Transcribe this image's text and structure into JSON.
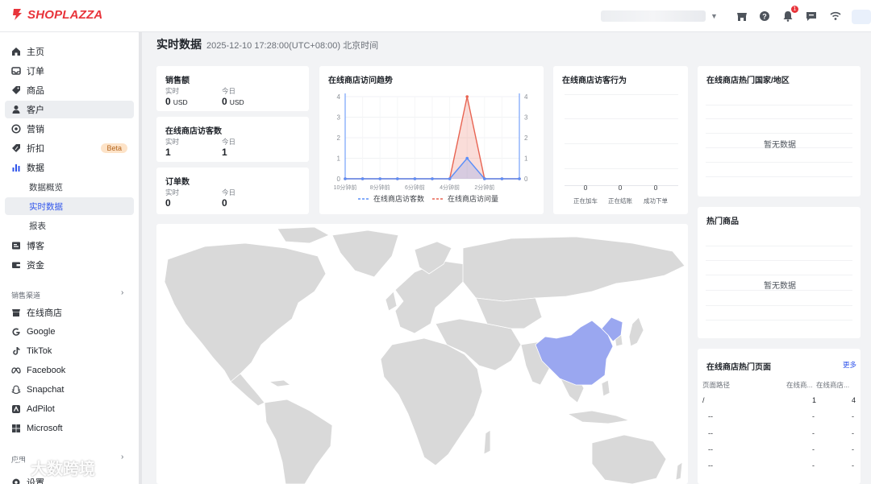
{
  "brand": {
    "name": "SHOPLAZZA",
    "accent": "#e8343b"
  },
  "topbar": {
    "icons": [
      "store-icon",
      "help-icon",
      "bell-icon",
      "message-icon",
      "wifi-icon"
    ],
    "notification_count": "1"
  },
  "sidebar": {
    "items": [
      {
        "label": "主页",
        "icon": "home-icon"
      },
      {
        "label": "订单",
        "icon": "inbox-icon"
      },
      {
        "label": "商品",
        "icon": "tag-icon"
      },
      {
        "label": "客户",
        "icon": "person-icon"
      },
      {
        "label": "营销",
        "icon": "target-icon"
      },
      {
        "label": "折扣",
        "icon": "discount-icon",
        "badge": "Beta"
      },
      {
        "label": "数据",
        "icon": "bar-chart-icon"
      },
      {
        "label": "数据概览"
      },
      {
        "label": "实时数据"
      },
      {
        "label": "报表"
      },
      {
        "label": "博客",
        "icon": "blog-icon"
      },
      {
        "label": "资金",
        "icon": "wallet-icon"
      }
    ],
    "channels_label": "销售渠道",
    "channels": [
      {
        "label": "在线商店",
        "icon": "store-icon"
      },
      {
        "label": "Google",
        "icon": "google-icon"
      },
      {
        "label": "TikTok",
        "icon": "tiktok-icon"
      },
      {
        "label": "Facebook",
        "icon": "meta-icon"
      },
      {
        "label": "Snapchat",
        "icon": "snapchat-icon"
      },
      {
        "label": "AdPilot",
        "icon": "adpilot-icon"
      },
      {
        "label": "Microsoft",
        "icon": "microsoft-icon"
      }
    ],
    "apps_label": "应用",
    "settings_label": "设置"
  },
  "header": {
    "title": "实时数据",
    "time": "2025-12-10 17:28:00(UTC+08:00) 北京时间"
  },
  "stats": [
    {
      "title": "销售额",
      "realtime_label": "实时",
      "today_label": "今日",
      "realtime": "0",
      "today": "0",
      "unit": "USD"
    },
    {
      "title": "在线商店访客数",
      "realtime_label": "实时",
      "today_label": "今日",
      "realtime": "1",
      "today": "1",
      "unit": ""
    },
    {
      "title": "订单数",
      "realtime_label": "实时",
      "today_label": "今日",
      "realtime": "0",
      "today": "0",
      "unit": ""
    }
  ],
  "trend": {
    "title": "在线商店访问趋势",
    "x_labels": [
      "10分钟前",
      "8分钟前",
      "6分钟前",
      "4分钟前",
      "2分钟前"
    ],
    "y_ticks": [
      "0",
      "1",
      "2",
      "3",
      "4"
    ],
    "legend": [
      "在线商店访客数",
      "在线商店访问量"
    ]
  },
  "chart_data": {
    "type": "line",
    "title": "在线商店访问趋势",
    "x": [
      10,
      9,
      8,
      7,
      6,
      5,
      4,
      3,
      2,
      1,
      0
    ],
    "xticks": [
      "10分钟前",
      "8分钟前",
      "6分钟前",
      "4分钟前",
      "2分钟前"
    ],
    "ylim": [
      0,
      4
    ],
    "series": [
      {
        "name": "在线商店访客数",
        "color": "#5b8ff9",
        "values": [
          0,
          0,
          0,
          0,
          0,
          0,
          0,
          1,
          0,
          0,
          0
        ]
      },
      {
        "name": "在线商店访问量",
        "color": "#e86452",
        "values": [
          0,
          0,
          0,
          0,
          0,
          0,
          0,
          4,
          0,
          0,
          0
        ]
      }
    ]
  },
  "behavior": {
    "title": "在线商店访客行为",
    "stages": [
      {
        "label": "正在加车",
        "value": "0"
      },
      {
        "label": "正在结账",
        "value": "0"
      },
      {
        "label": "成功下单",
        "value": "0"
      }
    ]
  },
  "countries": {
    "title": "在线商店热门国家/地区",
    "empty": "暂无数据"
  },
  "products": {
    "title": "热门商品",
    "empty": "暂无数据"
  },
  "pages": {
    "title": "在线商店热门页面",
    "more": "更多",
    "headers": [
      "页面路径",
      "在线商...",
      "在线商店..."
    ],
    "rows": [
      [
        "/",
        "1",
        "4"
      ],
      [
        "--",
        "-",
        "-"
      ],
      [
        "--",
        "-",
        "-"
      ],
      [
        "--",
        "-",
        "-"
      ],
      [
        "--",
        "-",
        "-"
      ]
    ]
  },
  "map": {
    "highlight_color": "#9aa7f0",
    "land_color": "#d9d9d9"
  },
  "watermark": "大数跨境"
}
